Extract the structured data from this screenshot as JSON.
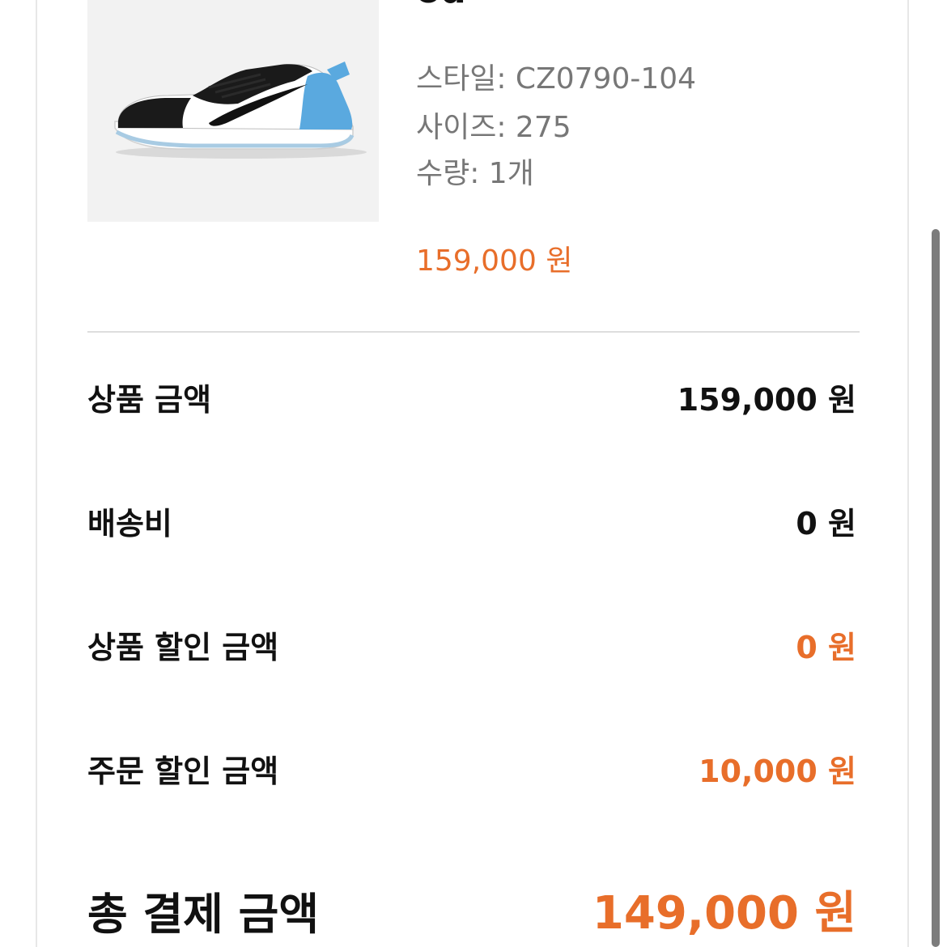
{
  "product": {
    "title": "od",
    "image_icon": "sneaker-image",
    "style": "스타일: CZ0790-104",
    "size": "사이즈: 275",
    "quantity": "수량: 1개",
    "price": "159,000 원"
  },
  "summary": {
    "rows": [
      {
        "label": "상품 금액",
        "value": "159,000 원"
      },
      {
        "label": "배송비",
        "value": "0 원"
      },
      {
        "label": "상품 할인 금액",
        "value": "0 원"
      },
      {
        "label": "주문 할인 금액",
        "value": "10,000 원"
      }
    ],
    "total_label": "총 결제 금액",
    "total_value": "149,000 원"
  },
  "colors": {
    "accent": "#e86e2a",
    "text": "#111111",
    "muted": "#777777",
    "divider": "#dedede",
    "image_background": "#f2f2f2"
  }
}
